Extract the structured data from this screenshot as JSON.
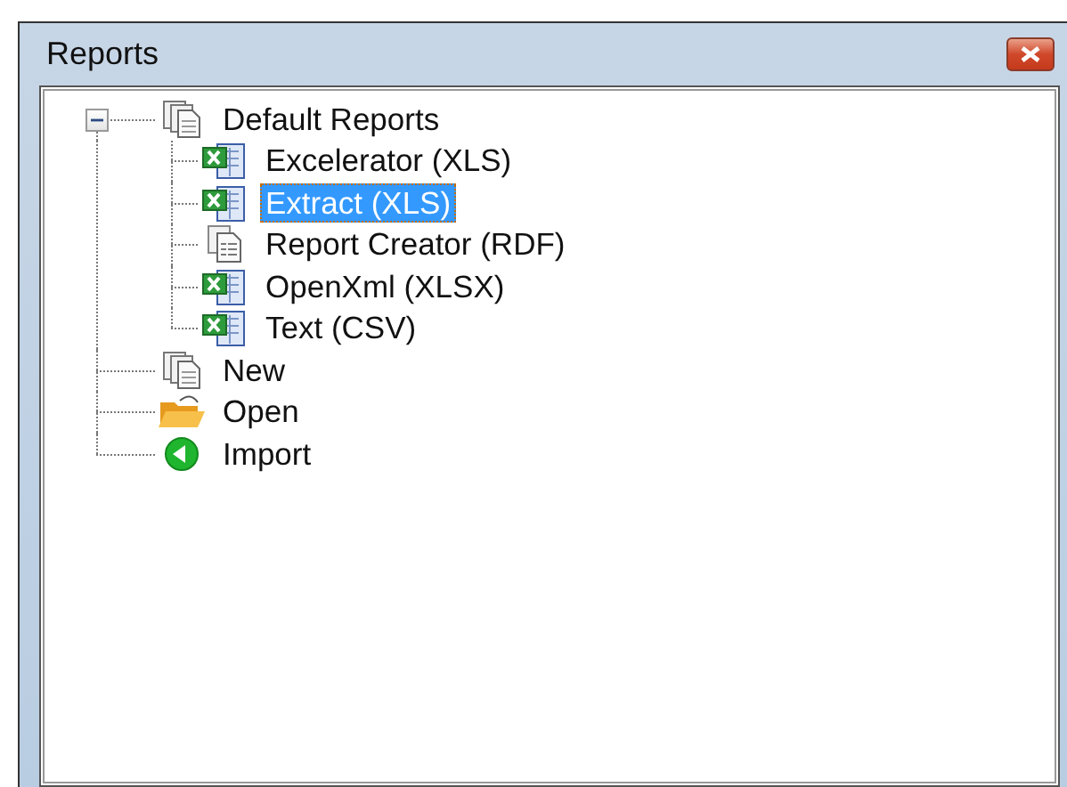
{
  "window": {
    "title": "Reports"
  },
  "tree": [
    {
      "label": "Default Reports",
      "kind": "doc-stack",
      "expanded": true,
      "selected": false,
      "children": [
        {
          "label": "Excelerator (XLS)",
          "kind": "excel",
          "selected": false
        },
        {
          "label": "Extract (XLS)",
          "kind": "excel",
          "selected": true
        },
        {
          "label": "Report Creator (RDF)",
          "kind": "report",
          "selected": false
        },
        {
          "label": "OpenXml (XLSX)",
          "kind": "excel",
          "selected": false
        },
        {
          "label": "Text (CSV)",
          "kind": "excel",
          "selected": false
        }
      ]
    },
    {
      "label": "New",
      "kind": "doc-stack",
      "selected": false
    },
    {
      "label": "Open",
      "kind": "folder",
      "selected": false
    },
    {
      "label": "Import",
      "kind": "import",
      "selected": false
    }
  ]
}
